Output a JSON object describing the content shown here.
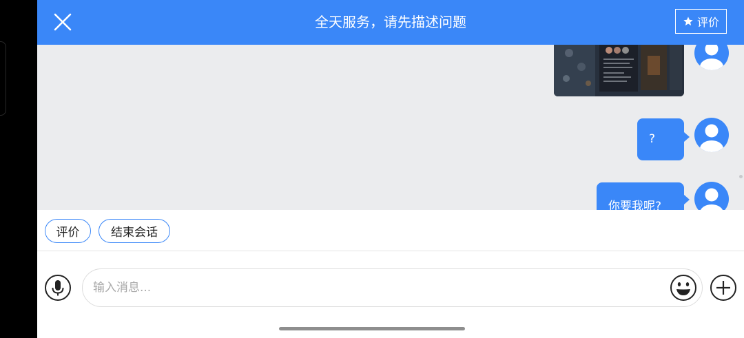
{
  "header": {
    "title": "全天服务，请先描述问题",
    "rate_label": "评价",
    "close_icon": "close-icon",
    "star_icon": "star-icon"
  },
  "chat": {
    "messages": [
      {
        "type": "image",
        "from": "user",
        "icon": "image-thumbnail"
      },
      {
        "type": "text",
        "from": "user",
        "text": "?"
      },
      {
        "type": "text",
        "from": "user",
        "text": "你要我呢?"
      }
    ]
  },
  "quick_actions": [
    {
      "label": "评价"
    },
    {
      "label": "结束会话"
    }
  ],
  "composer": {
    "placeholder": "输入消息...",
    "mic_icon": "microphone-icon",
    "emoji_icon": "emoji-icon",
    "plus_icon": "plus-icon"
  },
  "colors": {
    "accent": "#3a87f8",
    "chat_background": "#ebecee",
    "border": "#dcdcdc"
  }
}
